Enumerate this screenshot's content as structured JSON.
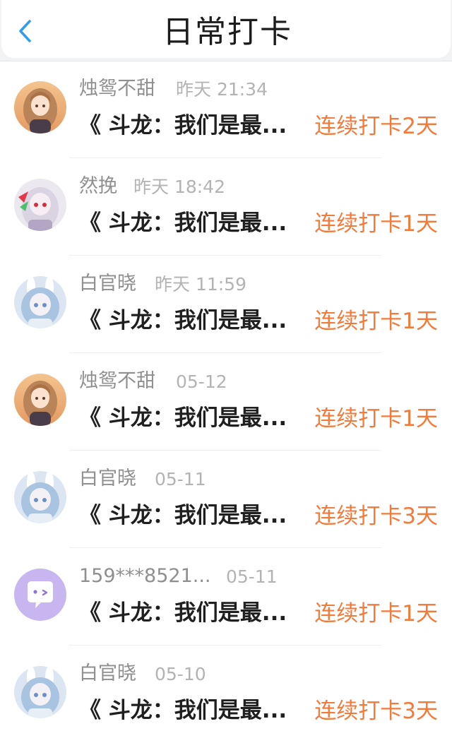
{
  "header": {
    "title": "日常打卡",
    "back_icon": "chevron-left-icon",
    "accent_color": "#2f9bf0"
  },
  "colors": {
    "streak": "#f27a3a",
    "name": "#8f8f8f",
    "time": "#b3b3b3"
  },
  "entries": [
    {
      "name": "烛鸳不甜",
      "time": "昨天 21:34",
      "title": "《 斗龙：我们是最...",
      "streak": "连续打卡2天",
      "avatar": "anime-girl-brown-hair-avatar"
    },
    {
      "name": "然挽",
      "time": "昨天 18:42",
      "title": "《 斗龙：我们是最...",
      "streak": "连续打卡1天",
      "avatar": "anime-girl-white-hair-red-eyes-avatar"
    },
    {
      "name": "白官晓",
      "time": "昨天 11:59",
      "title": "《 斗龙：我们是最...",
      "streak": "连续打卡1天",
      "avatar": "anime-girl-blue-hair-bunny-ears-avatar"
    },
    {
      "name": "烛鸳不甜",
      "time": "05-12",
      "title": "《 斗龙：我们是最...",
      "streak": "连续打卡1天",
      "avatar": "anime-girl-brown-hair-avatar"
    },
    {
      "name": "白官晓",
      "time": "05-11",
      "title": "《 斗龙：我们是最...",
      "streak": "连续打卡3天",
      "avatar": "anime-girl-blue-hair-bunny-ears-avatar"
    },
    {
      "name": "159***8521...",
      "time": "05-11",
      "title": "《 斗龙：我们是最...",
      "streak": "连续打卡1天",
      "avatar": "purple-chat-bubble-default-avatar"
    },
    {
      "name": "白官晓",
      "time": "05-10",
      "title": "《 斗龙：我们是最...",
      "streak": "连续打卡3天",
      "avatar": "anime-girl-blue-hair-bunny-ears-avatar"
    }
  ]
}
